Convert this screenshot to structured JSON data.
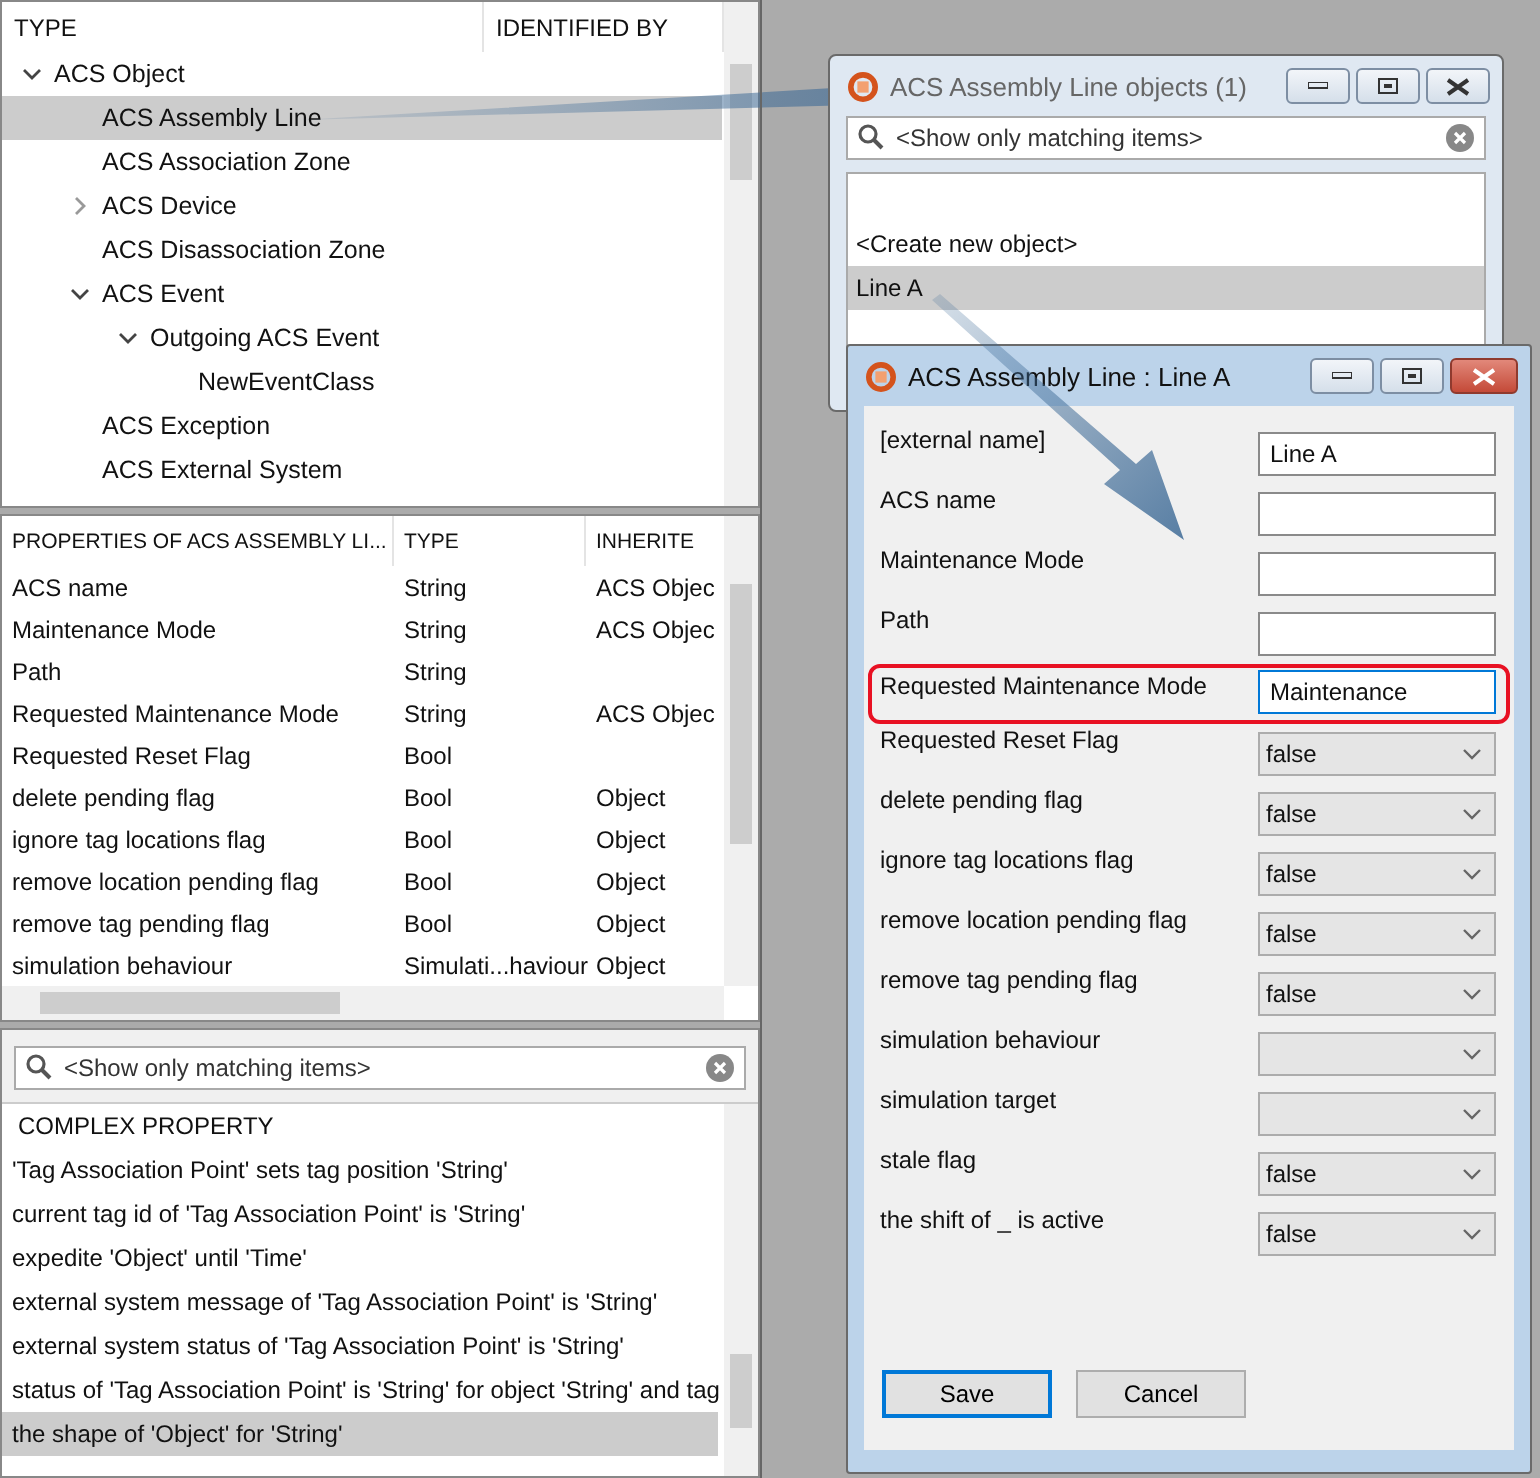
{
  "type_tree": {
    "columns": [
      "TYPE",
      "IDENTIFIED BY"
    ],
    "items": [
      {
        "label": "ACS Object",
        "expanded": true,
        "selected": false,
        "children": [
          {
            "label": "ACS Assembly Line",
            "selected": true
          },
          {
            "label": "ACS Association Zone",
            "selected": false
          },
          {
            "label": "ACS Device",
            "expanded": false,
            "selected": false
          },
          {
            "label": "ACS Disassociation Zone",
            "selected": false
          },
          {
            "label": "ACS Event",
            "expanded": true,
            "selected": false,
            "children": [
              {
                "label": "Outgoing ACS Event",
                "expanded": true,
                "selected": false,
                "children": [
                  {
                    "label": "NewEventClass",
                    "selected": false
                  }
                ]
              }
            ]
          },
          {
            "label": "ACS Exception",
            "selected": false
          },
          {
            "label": "ACS External System",
            "selected": false
          }
        ]
      }
    ]
  },
  "properties_table": {
    "columns": [
      "PROPERTIES OF ACS ASSEMBLY LI...",
      "TYPE",
      "INHERITE"
    ],
    "rows": [
      [
        "ACS name",
        "String",
        "ACS Objec"
      ],
      [
        "Maintenance Mode",
        "String",
        "ACS Objec"
      ],
      [
        "Path",
        "String",
        ""
      ],
      [
        "Requested Maintenance Mode",
        "String",
        "ACS Objec"
      ],
      [
        "Requested Reset Flag",
        "Bool",
        ""
      ],
      [
        "delete pending flag",
        "Bool",
        "Object"
      ],
      [
        "ignore tag locations flag",
        "Bool",
        "Object"
      ],
      [
        "remove location pending flag",
        "Bool",
        "Object"
      ],
      [
        "remove tag pending flag",
        "Bool",
        "Object"
      ],
      [
        "simulation behaviour",
        "Simulati...haviour",
        "Object"
      ]
    ]
  },
  "complex_search": {
    "placeholder": "<Show only matching items>"
  },
  "complex_list": {
    "heading": "COMPLEX PROPERTY",
    "items": [
      {
        "label": "'Tag Association Point' sets tag position 'String'",
        "selected": false
      },
      {
        "label": "current tag id of 'Tag Association Point' is 'String'",
        "selected": false
      },
      {
        "label": "expedite 'Object' until 'Time'",
        "selected": false
      },
      {
        "label": "external system message of 'Tag Association Point' is 'String'",
        "selected": false
      },
      {
        "label": "external system status of 'Tag Association Point' is 'String'",
        "selected": false
      },
      {
        "label": "status of 'Tag Association Point' is 'String' for object 'String' and tag",
        "selected": false
      },
      {
        "label": "the shape of 'Object' for 'String'",
        "selected": true
      }
    ]
  },
  "objects_window": {
    "title": "ACS Assembly Line objects (1)",
    "search": {
      "placeholder": "<Show only matching items>"
    },
    "items": [
      {
        "label": "<Create new object>",
        "selected": false
      },
      {
        "label": "Line A",
        "selected": true
      }
    ]
  },
  "edit_window": {
    "title": "ACS Assembly Line : Line A",
    "fields": [
      {
        "label": "[external name]",
        "kind": "text",
        "value": "Line A",
        "highlighted": false
      },
      {
        "label": "ACS name",
        "kind": "text",
        "highlighted": false
      },
      {
        "label": "Maintenance Mode",
        "kind": "text",
        "highlighted": false
      },
      {
        "label": "Path",
        "kind": "text",
        "highlighted": false
      },
      {
        "label": "Requested Maintenance Mode",
        "kind": "text",
        "value": "Maintenance",
        "highlighted": true
      },
      {
        "label": "Requested Reset Flag",
        "kind": "dropdown",
        "value": "false",
        "highlighted": false
      },
      {
        "label": "delete pending flag",
        "kind": "dropdown",
        "value": "false",
        "highlighted": false
      },
      {
        "label": "ignore tag locations flag",
        "kind": "dropdown",
        "value": "false",
        "highlighted": false
      },
      {
        "label": "remove location pending flag",
        "kind": "dropdown",
        "value": "false",
        "highlighted": false
      },
      {
        "label": "remove tag pending flag",
        "kind": "dropdown",
        "value": "false",
        "highlighted": false
      },
      {
        "label": "simulation behaviour",
        "kind": "dropdown",
        "highlighted": false
      },
      {
        "label": "simulation target",
        "kind": "dropdown",
        "highlighted": false
      },
      {
        "label": "stale flag",
        "kind": "dropdown",
        "value": "false",
        "highlighted": false
      },
      {
        "label": "the shift of _ is active",
        "kind": "dropdown",
        "value": "false",
        "highlighted": false
      }
    ],
    "buttons": [
      {
        "label": "Save",
        "default": true
      },
      {
        "label": "Cancel",
        "default": false
      }
    ]
  }
}
